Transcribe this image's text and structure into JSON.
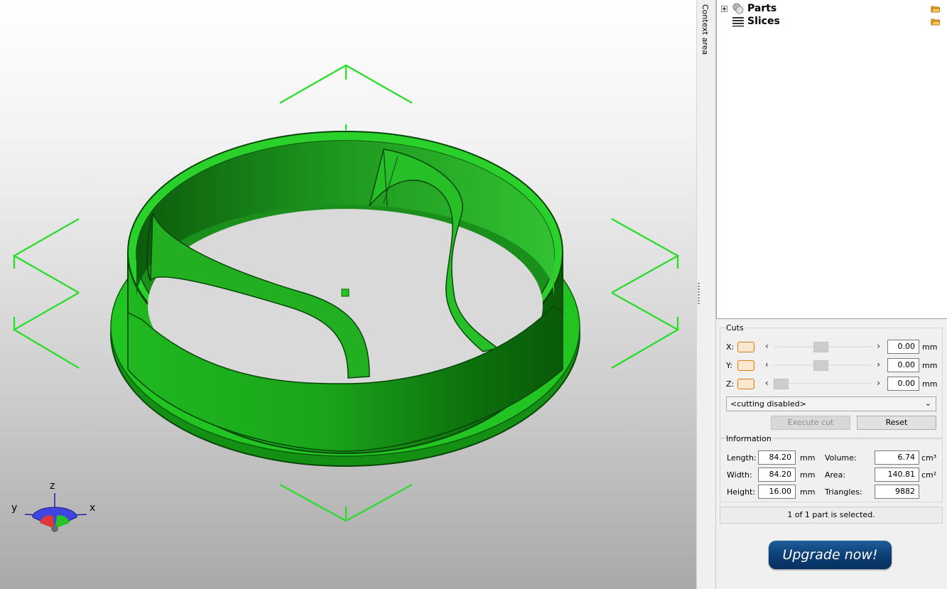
{
  "context_area": {
    "label": "Context area"
  },
  "viewport": {
    "axes": {
      "z": "z",
      "y": "y",
      "x": "x"
    },
    "model_color": "#2fd12f",
    "handle_color": "#2ddc2d"
  },
  "tree": {
    "items": [
      {
        "label": "Parts",
        "icon": "spheres-icon"
      },
      {
        "label": "Slices",
        "icon": "layers-icon"
      }
    ]
  },
  "cuts": {
    "legend": "Cuts",
    "rows": [
      {
        "axis": "X:",
        "value": "0.00",
        "unit": "mm",
        "thumb_fraction": 0.48
      },
      {
        "axis": "Y:",
        "value": "0.00",
        "unit": "mm",
        "thumb_fraction": 0.48
      },
      {
        "axis": "Z:",
        "value": "0.00",
        "unit": "mm",
        "thumb_fraction": 0.0
      }
    ],
    "mode_select": "<cutting disabled>",
    "execute_label": "Execute cut",
    "reset_label": "Reset"
  },
  "information": {
    "legend": "Information",
    "length_label": "Length:",
    "length_value": "84.20",
    "length_unit": "mm",
    "width_label": "Width:",
    "width_value": "84.20",
    "width_unit": "mm",
    "height_label": "Height:",
    "height_value": "16.00",
    "height_unit": "mm",
    "volume_label": "Volume:",
    "volume_value": "6.74",
    "volume_unit": "cm³",
    "area_label": "Area:",
    "area_value": "140.81",
    "area_unit": "cm²",
    "triangles_label": "Triangles:",
    "triangles_value": "9882"
  },
  "status": "1 of 1 part is selected.",
  "upgrade_label": "Upgrade now!"
}
